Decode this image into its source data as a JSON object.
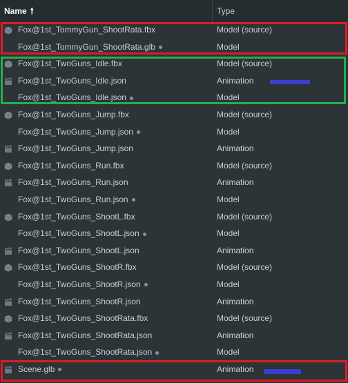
{
  "header": {
    "name_label": "Name",
    "sort_arrow": "🠕",
    "type_label": "Type"
  },
  "rows": [
    {
      "name": "Fox@1st_TommyGun_ShootRata.fbx",
      "type": "Model (source)",
      "icon": "cube-icon",
      "dot": false
    },
    {
      "name": "Fox@1st_TommyGun_ShootRata.glb",
      "type": "Model",
      "icon": "none",
      "dot": true
    },
    {
      "name": "Fox@1st_TwoGuns_Idle.fbx",
      "type": "Model (source)",
      "icon": "cube-icon",
      "dot": false
    },
    {
      "name": "Fox@1st_TwoGuns_Idle.json",
      "type": "Animation",
      "icon": "clapper-icon",
      "dot": false
    },
    {
      "name": "Fox@1st_TwoGuns_Idle.json",
      "type": "Model",
      "icon": "none",
      "dot": true
    },
    {
      "name": "Fox@1st_TwoGuns_Jump.fbx",
      "type": "Model (source)",
      "icon": "cube-icon",
      "dot": false
    },
    {
      "name": "Fox@1st_TwoGuns_Jump.json",
      "type": "Model",
      "icon": "none",
      "dot": true
    },
    {
      "name": "Fox@1st_TwoGuns_Jump.json",
      "type": "Animation",
      "icon": "clapper-icon",
      "dot": false
    },
    {
      "name": "Fox@1st_TwoGuns_Run.fbx",
      "type": "Model (source)",
      "icon": "cube-icon",
      "dot": false
    },
    {
      "name": "Fox@1st_TwoGuns_Run.json",
      "type": "Animation",
      "icon": "clapper-icon",
      "dot": false
    },
    {
      "name": "Fox@1st_TwoGuns_Run.json",
      "type": "Model",
      "icon": "none",
      "dot": true
    },
    {
      "name": "Fox@1st_TwoGuns_ShootL.fbx",
      "type": "Model (source)",
      "icon": "cube-icon",
      "dot": false
    },
    {
      "name": "Fox@1st_TwoGuns_ShootL.json",
      "type": "Model",
      "icon": "none",
      "dot": true
    },
    {
      "name": "Fox@1st_TwoGuns_ShootL.json",
      "type": "Animation",
      "icon": "clapper-icon",
      "dot": false
    },
    {
      "name": "Fox@1st_TwoGuns_ShootR.fbx",
      "type": "Model (source)",
      "icon": "cube-icon",
      "dot": false
    },
    {
      "name": "Fox@1st_TwoGuns_ShootR.json",
      "type": "Model",
      "icon": "none",
      "dot": true
    },
    {
      "name": "Fox@1st_TwoGuns_ShootR.json",
      "type": "Animation",
      "icon": "clapper-icon",
      "dot": false
    },
    {
      "name": "Fox@1st_TwoGuns_ShootRata.fbx",
      "type": "Model (source)",
      "icon": "cube-icon",
      "dot": false
    },
    {
      "name": "Fox@1st_TwoGuns_ShootRata.json",
      "type": "Animation",
      "icon": "clapper-icon",
      "dot": false
    },
    {
      "name": "Fox@1st_TwoGuns_ShootRata.json",
      "type": "Model",
      "icon": "none",
      "dot": true
    },
    {
      "name": "Scene.glb",
      "type": "Animation",
      "icon": "clapper-icon",
      "dot": true
    }
  ],
  "colors": {
    "background": "#2c3438",
    "header_bg": "#262d31",
    "text": "#c9cdd0",
    "highlight_red": "#e01b24",
    "highlight_green": "#22b14c",
    "marker_blue": "#3b3fd0"
  }
}
